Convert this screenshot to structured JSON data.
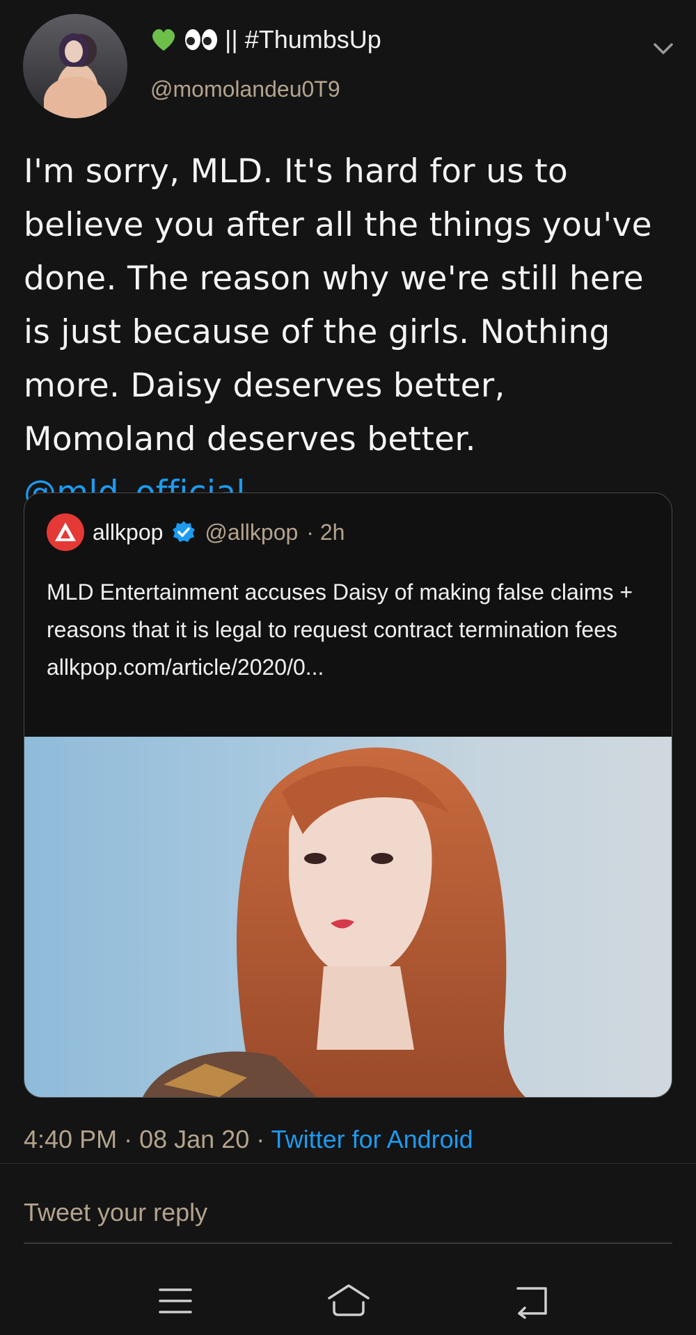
{
  "author": {
    "display_name": "|| #ThumbsUp",
    "handle": "@momolandeu0T9"
  },
  "tweet": {
    "text": "I'm sorry, MLD. It's hard for us to believe you after all the things you've done. The reason why we're still here is just because of the girls. Nothing more. Daisy deserves better, Momoland deserves better.",
    "mention": "@mld_official_"
  },
  "quote": {
    "name": "allkpop",
    "handle": "@allkpop",
    "time": "· 2h",
    "body": "MLD Entertainment accuses Daisy of making false claims + reasons that it is legal to request contract termination fees",
    "link": "allkpop.com/article/2020/0..."
  },
  "meta": {
    "time": "4:40 PM",
    "date": "· 08 Jan 20 ·",
    "source": "Twitter for Android"
  },
  "reply": {
    "placeholder": "Tweet your reply"
  },
  "colors": {
    "link": "#1d9bf0",
    "muted": "#b4a48e",
    "background": "#141414",
    "verified": "#1d9bf0"
  },
  "icons": [
    "green-heart-icon",
    "eyes-icon",
    "chevron-down-icon",
    "allkpop-logo-icon",
    "verified-badge-icon",
    "menu-icon",
    "home-icon",
    "back-icon"
  ]
}
